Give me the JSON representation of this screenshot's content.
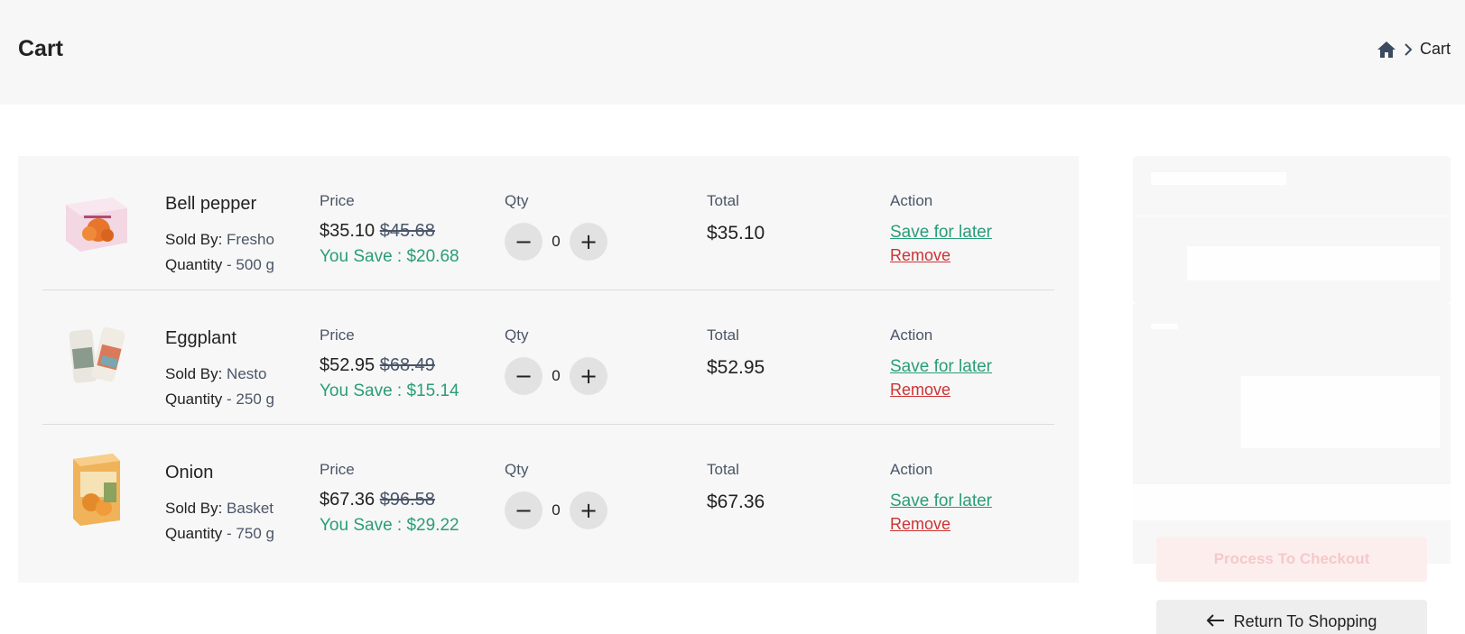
{
  "header": {
    "title": "Cart",
    "breadcrumb": {
      "current": "Cart"
    }
  },
  "columns": {
    "price": "Price",
    "qty": "Qty",
    "total": "Total",
    "action": "Action"
  },
  "labels": {
    "sold_by": "Sold By:",
    "quantity": "Quantity",
    "save_for_later": "Save for later",
    "remove": "Remove"
  },
  "items": [
    {
      "name": "Bell pepper",
      "seller": "Fresho",
      "quantity": "- 500 g",
      "price": "$35.10",
      "old_price": "$45.68",
      "you_save": "You Save : $20.68",
      "qty": "0",
      "total": "$35.10"
    },
    {
      "name": "Eggplant",
      "seller": "Nesto",
      "quantity": "- 250 g",
      "price": "$52.95",
      "old_price": "$68.49",
      "you_save": "You Save : $15.14",
      "qty": "0",
      "total": "$52.95"
    },
    {
      "name": "Onion",
      "seller": "Basket",
      "quantity": "- 750 g",
      "price": "$67.36",
      "old_price": "$96.58",
      "you_save": "You Save : $29.22",
      "qty": "0",
      "total": "$67.36"
    }
  ],
  "summary": {
    "checkout_label": "Process To Checkout",
    "return_label": "Return To Shopping"
  },
  "colors": {
    "accent_green": "#2a9d78",
    "remove_red": "#cc3333",
    "panel_bg": "#f7f7f7"
  }
}
